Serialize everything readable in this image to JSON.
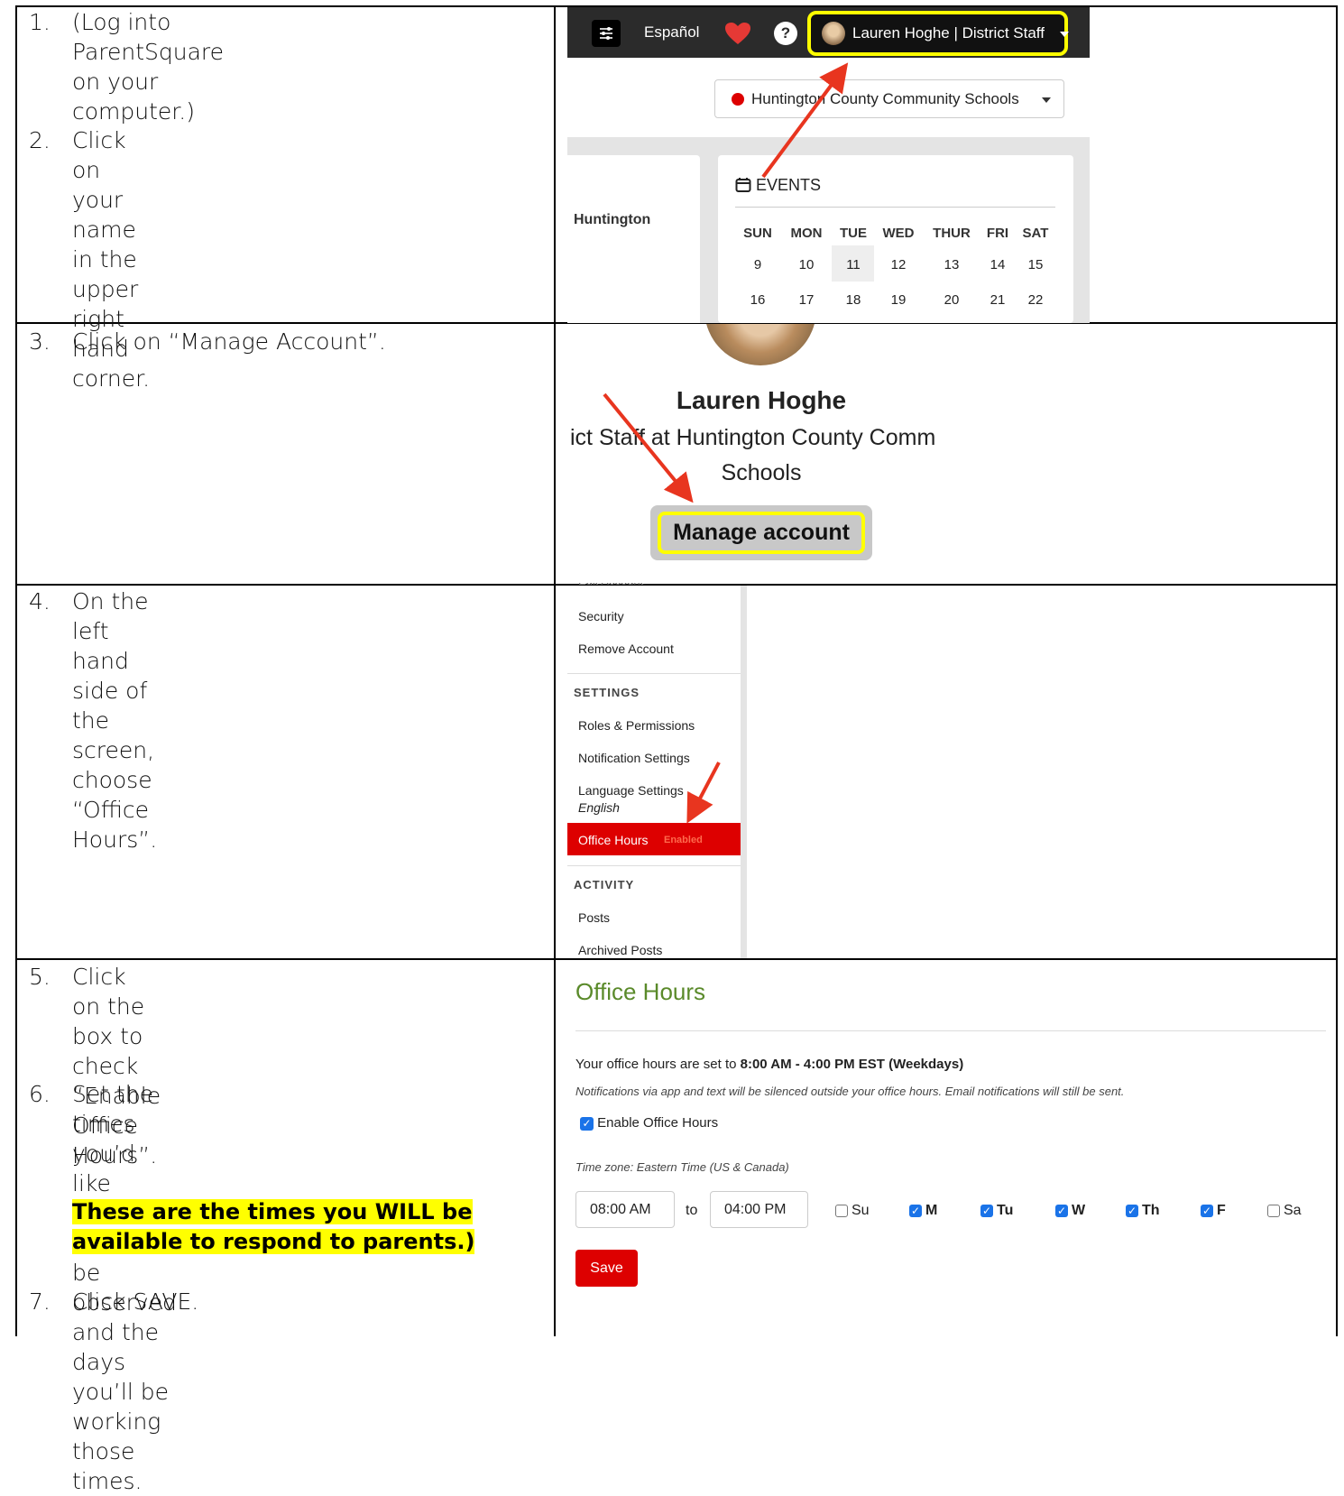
{
  "steps": {
    "s1": {
      "num": "1.",
      "text": "(Log into ParentSquare on your\ncomputer.)"
    },
    "s2": {
      "num": "2.",
      "text": "Click on your name in the upper right\nhand corner."
    },
    "s3": {
      "num": "3.",
      "text": "Click on “Manage Account”."
    },
    "s4": {
      "num": "4.",
      "text": "On the left hand side of the screen,\nchoose “Office Hours”."
    },
    "s5": {
      "num": "5.",
      "text": "Click on the box to check “Enable\nOffice Hours”."
    },
    "s6": {
      "num": "6.",
      "text": "Set the times you’d like office hours to\nbe observed and the days you’ll be\nworking those times."
    },
    "s7": {
      "num": "7.",
      "text": "Click SAVE."
    },
    "note_line1": "These are the times you WILL be",
    "note_line2": "available to respond to parents.)"
  },
  "panel1": {
    "language": "Español",
    "help": "?",
    "user_label": "Lauren Hoghe | District Staff",
    "school_selector": "Huntington County Community Schools",
    "left_label": "Huntington",
    "events_title": "EVENTS",
    "days": [
      "SUN",
      "MON",
      "TUE",
      "WED",
      "THUR",
      "FRI",
      "SAT"
    ],
    "week1": [
      "9",
      "10",
      "11",
      "12",
      "13",
      "14",
      "15"
    ],
    "week2": [
      "16",
      "17",
      "18",
      "19",
      "20",
      "21",
      "22"
    ]
  },
  "panel2": {
    "name": "Lauren Hoghe",
    "role_line1": "ict Staff at Huntington County Comm",
    "role_line2": "Schools",
    "manage_button": "Manage account"
  },
  "panel3": {
    "items_top": [
      "Security",
      "Remove Account"
    ],
    "settings_heading": "SETTINGS",
    "settings_items": [
      "Roles & Permissions",
      "Notification Settings",
      "Language Settings"
    ],
    "language_value": "English",
    "office_hours_item": "Office Hours",
    "office_hours_badge": "Enabled",
    "activity_heading": "ACTIVITY",
    "activity_items": [
      "Posts",
      "Archived Posts"
    ]
  },
  "panel4": {
    "title": "Office Hours",
    "set_prefix": "Your office hours are set to ",
    "set_value": "8:00 AM - 4:00 PM EST (Weekdays)",
    "notice": "Notifications via app and text will be silenced outside your office hours. Email notifications will still be sent.",
    "enable_label": "Enable Office Hours",
    "timezone": "Time zone: Eastern Time (US & Canada)",
    "start_time": "08:00 AM",
    "to_label": "to",
    "end_time": "04:00 PM",
    "days": [
      {
        "label": "Su",
        "checked": false
      },
      {
        "label": "M",
        "checked": true
      },
      {
        "label": "Tu",
        "checked": true
      },
      {
        "label": "W",
        "checked": true
      },
      {
        "label": "Th",
        "checked": true
      },
      {
        "label": "F",
        "checked": true
      },
      {
        "label": "Sa",
        "checked": false
      }
    ],
    "save_button": "Save"
  },
  "colors": {
    "highlight": "#ffff00",
    "accent_red": "#dd0000",
    "green_title": "#5a8a2a",
    "arrow": "#e8351f",
    "yellow_box": "#ffff00"
  }
}
